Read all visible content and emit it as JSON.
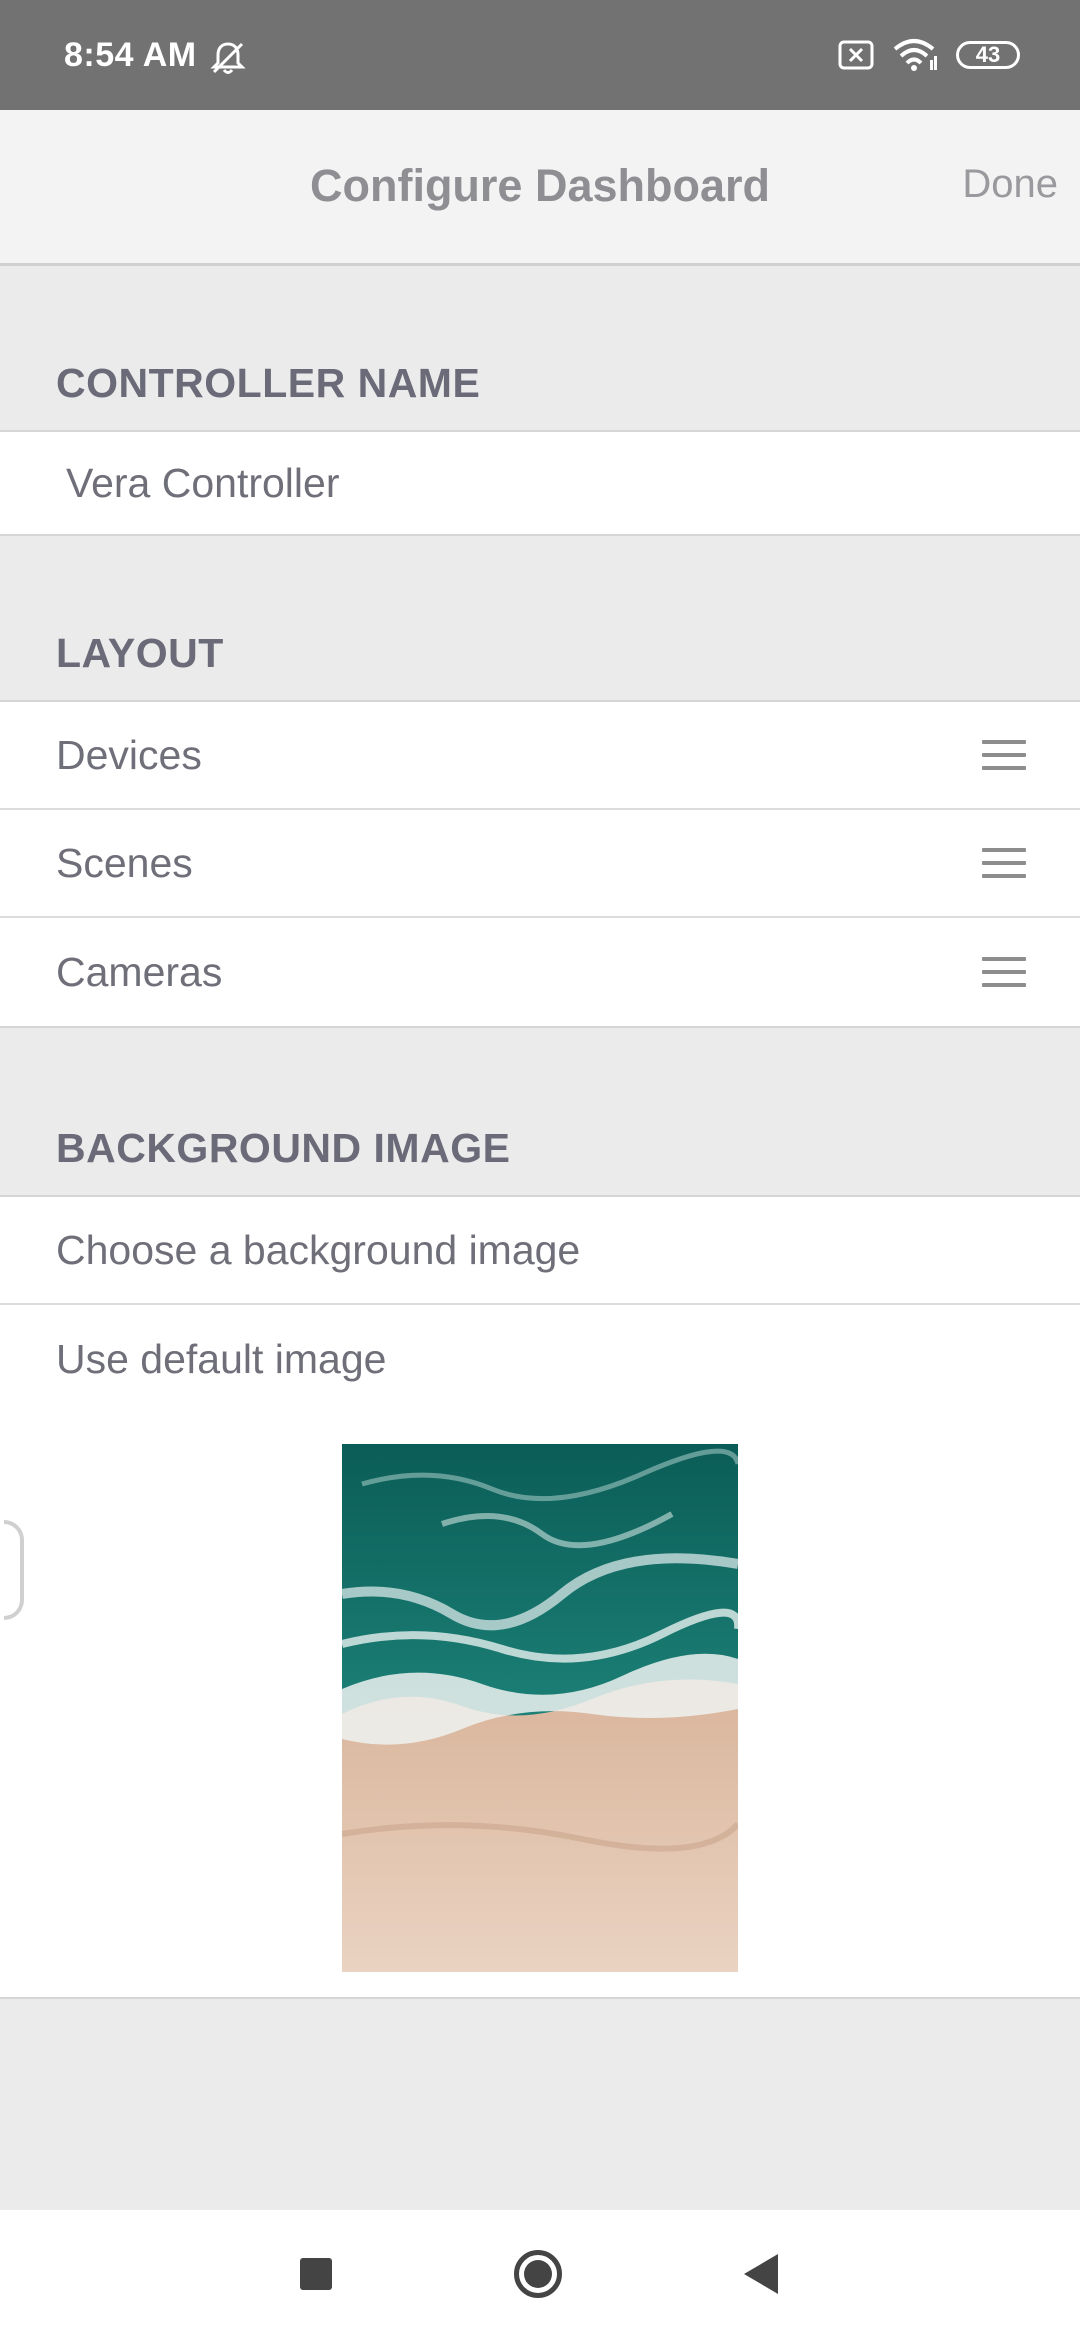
{
  "status_bar": {
    "time": "8:54 AM",
    "battery": "43"
  },
  "header": {
    "title": "Configure Dashboard",
    "done_label": "Done"
  },
  "controller_name": {
    "header": "CONTROLLER NAME",
    "value": "Vera Controller"
  },
  "layout": {
    "header": "LAYOUT",
    "items": [
      {
        "label": "Devices"
      },
      {
        "label": "Scenes"
      },
      {
        "label": "Cameras"
      }
    ]
  },
  "background_image": {
    "header": "BACKGROUND IMAGE",
    "choose_label": "Choose a background image",
    "default_label": "Use default image"
  },
  "colors": {
    "status_bar": "#727272",
    "nav_bar": "#f3f3f3",
    "page_bg": "#ebebeb",
    "text_secondary": "#6f6f7a"
  }
}
